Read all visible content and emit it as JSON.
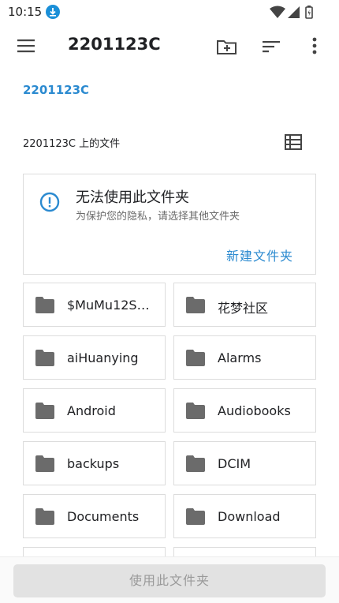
{
  "status_bar": {
    "time": "10:15"
  },
  "toolbar": {
    "title": "2201123C"
  },
  "breadcrumb": "2201123C",
  "files_header": "2201123C 上的文件",
  "warning": {
    "title": "无法使用此文件夹",
    "subtitle": "为保护您的隐私，请选择其他文件夹",
    "action": "新建文件夹"
  },
  "folders": [
    {
      "label": "$MuMu12Sh..."
    },
    {
      "label": "花梦社区"
    },
    {
      "label": "aiHuanying"
    },
    {
      "label": "Alarms"
    },
    {
      "label": "Android"
    },
    {
      "label": "Audiobooks"
    },
    {
      "label": "backups"
    },
    {
      "label": "DCIM"
    },
    {
      "label": "Documents"
    },
    {
      "label": "Download"
    }
  ],
  "bottom": {
    "use_folder_label": "使用此文件夹"
  },
  "colors": {
    "accent": "#2b8ad0",
    "folder_icon": "#6b6b6b",
    "disabled_button": "#e2e2e2"
  }
}
